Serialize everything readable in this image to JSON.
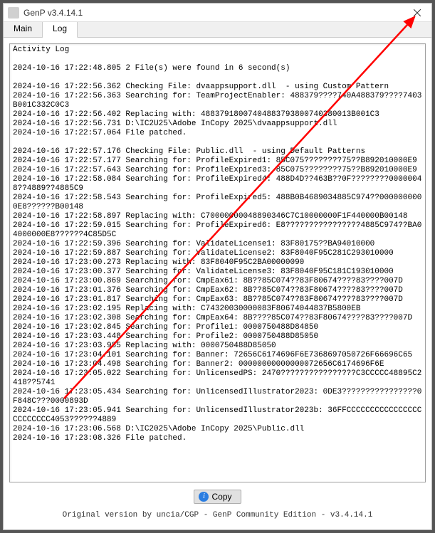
{
  "window": {
    "title": "GenP v3.4.14.1"
  },
  "tabs": {
    "main": "Main",
    "log": "Log"
  },
  "log": {
    "header": "Activity Log",
    "lines": [
      "2024-10-16 17:22:48.805 2 File(s) were found in 6 second(s)",
      "",
      "2024-10-16 17:22:56.362 Checking File: dvaappsupport.dll  - using Custom Pattern",
      "2024-10-16 17:22:56.363 Searching for: TeamProjectEnabler: 488379????740A488379????7403B001C332C0C3",
      "2024-10-16 17:22:56.402 Replacing with: 48837918007404883793800740380013B001C3",
      "2024-10-16 17:22:56.731 D:\\IC2U25\\Adobe InCopy 2025\\dvaappsupport.dll",
      "2024-10-16 17:22:57.064 File patched.",
      "",
      "2024-10-16 17:22:57.176 Checking File: Public.dll  - using Default Patterns",
      "2024-10-16 17:22:57.177 Searching for: ProfileExpired1: 85C075????????75??B892010000E9",
      "2024-10-16 17:22:57.643 Searching for: ProfileExpired3: 85C075????????75??B892010000E9",
      "2024-10-16 17:22:58.084 Searching for: ProfileExpired4: 488D4D??463B??0F????????00000048??4889??4885C9",
      "2024-10-16 17:22:58.543 Searching for: ProfileExpired5: 488B0B4689034885C974??0000000000E8??????B00148",
      "2024-10-16 17:22:58.897 Replacing with: C70000000048890346C7C10000000F1F440000B00148",
      "2024-10-16 17:22:59.015 Searching for: ProfileExpired6: E8????????????????4885C974??BA04000000E8??????4C85D5C",
      "2024-10-16 17:22:59.396 Searching for: ValidateLicense1: 83F80175??BA94010000",
      "2024-10-16 17:22:59.887 Searching for: ValidateLicense2: 83F8040F95C281C293010000",
      "2024-10-16 17:23:00.273 Replacing with: 83F8040F95C2BA00000090",
      "2024-10-16 17:23:00.377 Searching for: ValidateLicense3: 83F8040F95C181C193010000",
      "2024-10-16 17:23:00.869 Searching for: CmpEax61: 8B??85C074??83F80674????83????007D",
      "2024-10-16 17:23:01.376 Searching for: CmpEax62: 8B??85C074??83F80674????83????007D",
      "2024-10-16 17:23:01.817 Searching for: CmpEax63: 8B??85C074??83F80674????83????007D",
      "2024-10-16 17:23:02.195 Replacing with: C74320030000083F80674044837B5800EB",
      "2024-10-16 17:23:02.308 Searching for: CmpEax64: 8B????85C074??83F80674????83????007D",
      "2024-10-16 17:23:02.845 Searching for: Profile1: 0000750488D84850",
      "2024-10-16 17:23:03.448 Searching for: Profile2: 0000750488D85050",
      "2024-10-16 17:23:03.985 Replacing with: 0000750488D85050",
      "2024-10-16 17:23:04.101 Searching for: Banner: 72656C6174696F6E7368697050726F66696C65",
      "2024-10-16 17:23:04.498 Searching for: Banner2: 00000000000000072656C6174696F6E",
      "2024-10-16 17:23:05.022 Searching for: UnlicensedPS: 2470????????????????C3CCCCC48895C2418??5741",
      "2024-10-16 17:23:05.434 Searching for: UnlicensedIllustrator2023: 0DE3????????????????0F848C???0000893D",
      "2024-10-16 17:23:05.941 Searching for: UnlicensedIllustrator2023b: 36FFCCCCCCCCCCCCCCCCCCCCCCCC4053??????4889",
      "2024-10-16 17:23:06.568 D:\\IC2025\\Adobe InCopy 2025\\Public.dll",
      "2024-10-16 17:23:08.326 File patched."
    ]
  },
  "buttons": {
    "copy": "Copy"
  },
  "footer": {
    "text": "Original version by uncia/CGP - GenP Community Edition - v3.4.14.1"
  },
  "colors": {
    "arrow": "#ff0000"
  }
}
